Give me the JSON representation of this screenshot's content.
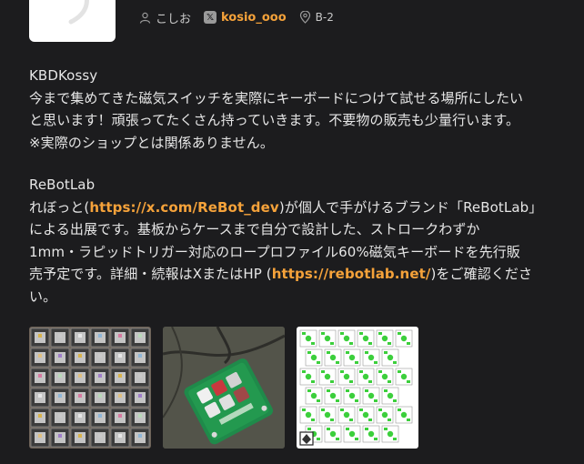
{
  "vendor": {
    "name": "こしお",
    "x_handle": "kosio_ooo",
    "booth": "B-2"
  },
  "sections": [
    {
      "title": "KBDKossy",
      "lines": [
        "今まで集めてきた磁気スイッチを実際にキーボードにつけて試せる場所にしたい",
        "と思います！頑張ってたくさん持っていきます。不要物の販売も少量行います。",
        "※実際のショップとは関係ありません。"
      ]
    },
    {
      "title": "ReBotLab",
      "p1_before": "れぼっと(",
      "p1_link": "https://x.com/ReBot_dev",
      "p1_after": ")が個人で手がけるブランド「ReBotLab」",
      "line2": "による出展です。基板からケースまで自分で設計した、ストロークわずか",
      "line3": "1mm・ラピッドトリガー対応のロープロファイル60%磁気キーボードを先行販",
      "p4_before": "売予定です。詳細・続報はXまたはHP (",
      "p4_link": "https://rebotlab.net/",
      "p4_after": ")をご確認くださ",
      "line5": "い。"
    }
  ],
  "colors": {
    "background": "#1c1c1e",
    "link": "#f5a23a",
    "text": "#e6e6e6"
  }
}
